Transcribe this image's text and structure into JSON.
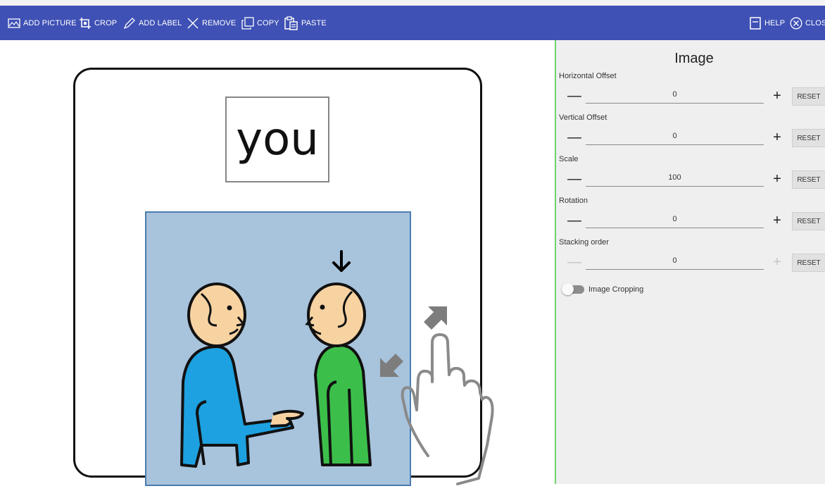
{
  "toolbar": {
    "add_picture": "ADD PICTURE",
    "crop": "CROP",
    "add_label": "ADD LABEL",
    "remove": "REMOVE",
    "copy": "COPY",
    "paste": "PASTE",
    "help": "HELP",
    "close": "CLOS"
  },
  "card": {
    "label_text": "you"
  },
  "panel": {
    "title": "Image",
    "properties": [
      {
        "label": "Horizontal Offset",
        "value": "0",
        "reset": "RESET"
      },
      {
        "label": "Vertical Offset",
        "value": "0",
        "reset": "RESET"
      },
      {
        "label": "Scale",
        "value": "100",
        "reset": "RESET"
      },
      {
        "label": "Rotation",
        "value": "0",
        "reset": "RESET"
      },
      {
        "label": "Stacking order",
        "value": "0",
        "reset": "RESET"
      }
    ],
    "cropping_label": "Image Cropping",
    "cropping_enabled": false
  },
  "colors": {
    "toolbar": "#3f51b5",
    "divider": "#6fd36f",
    "picture_bg": "#a8c3dc",
    "person_blue": "#1da1e0",
    "person_green": "#3cbf4a",
    "skin": "#f8d3a2"
  }
}
